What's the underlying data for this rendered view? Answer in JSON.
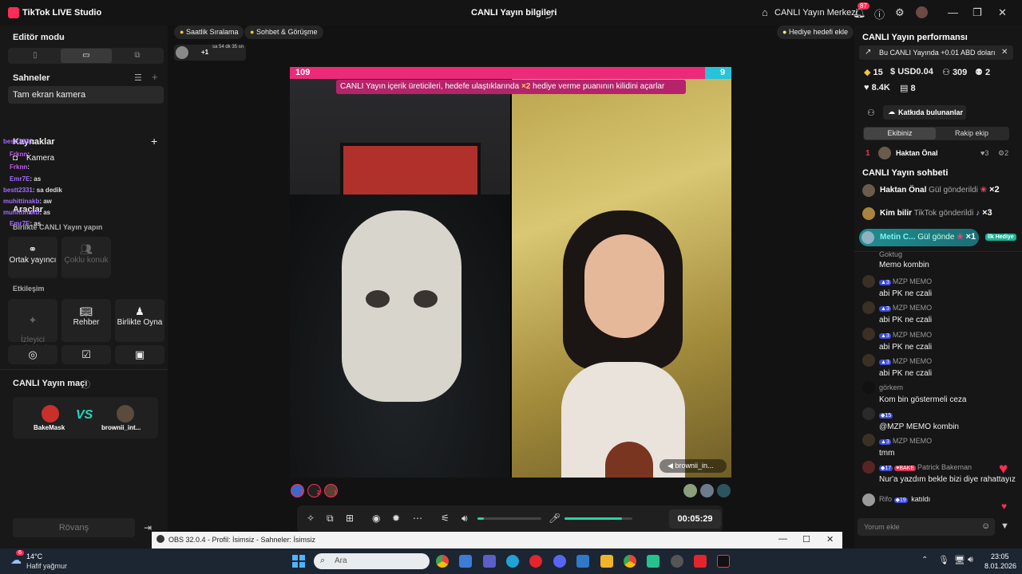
{
  "titlebar": {
    "app_name": "TikTok LIVE Studio",
    "center_title": "CANLI Yayın bilgileri",
    "live_center": "CANLI Yayın Merkezi",
    "notification_count": "87"
  },
  "left": {
    "editor_mode": "Editör modu",
    "scenes_label": "Sahneler",
    "scene_item": "Tam ekran kamera",
    "sources_label": "Kaynaklar",
    "source_camera": "Kamera",
    "tools_label": "Araçlar",
    "collab_label": "Birlikte CANLI Yayın yapın",
    "tiles_collab": [
      {
        "label": "Ortak yayıncı",
        "icon": "link-icon"
      },
      {
        "label": "Çoklu konuk",
        "icon": "people-icon"
      }
    ],
    "interaction_label": "Etkileşim",
    "tiles_interaction": [
      {
        "label": "İzleyici\nDilekleri",
        "icon": "wish-icon"
      },
      {
        "label": "Rehber",
        "icon": "book-icon"
      },
      {
        "label": "Birlikte Oyna",
        "icon": "play-together-icon"
      }
    ],
    "chat_overlay": [
      {
        "user": "bestt2331",
        "msg": ":"
      },
      {
        "user": "Frknn",
        "msg": ":"
      },
      {
        "user": "Frknn",
        "msg": ":"
      },
      {
        "user": "Emr7E",
        "msg": ": as"
      },
      {
        "user": "bestt2331",
        "msg": ": sa dedik"
      },
      {
        "user": "muhittinakb",
        "msg": ": aw"
      },
      {
        "user": "muhittinakb",
        "msg": ": as"
      },
      {
        "user": "Emr7E",
        "msg": ": as"
      }
    ],
    "match_label": "CANLI Yayın maçı",
    "match_players": [
      "BakeMask",
      "brownii_int..."
    ],
    "rematch_button": "Rövanş"
  },
  "center": {
    "pills": [
      "Saatlik Sıralama",
      "Sohbet & Görüşme"
    ],
    "gift_goal": "Hediye hedefi ekle",
    "ranking_small": "sa 54 dk 35 sn",
    "ranking_plus": "+1",
    "score_left": "109",
    "score_right": "9",
    "banner_pre": "CANLI Yayın içerik üreticileri, hedefe ulaştıklarında ",
    "banner_mult": "×2",
    "banner_post": " hediye verme puanının kilidini açarlar",
    "guest_name": "brownii_in...",
    "viewer_counts": [
      "3",
      "2",
      "1"
    ],
    "timer": "00:05:29",
    "volume_level": 0.1,
    "mic_level": 0.85
  },
  "obs": {
    "title": "OBS 32.0.4 - Profil: İsimsiz - Sahneler: İsimsiz"
  },
  "right": {
    "perf_title": "CANLI Yayın performansı",
    "perf_note": "Bu CANLI Yayında +0.01 ABD doları",
    "stats": [
      {
        "icon": "diamond-icon",
        "value": "15"
      },
      {
        "icon": "dollar-icon",
        "value": "USD0.04"
      },
      {
        "icon": "viewers-icon",
        "value": "309"
      },
      {
        "icon": "people-icon",
        "value": "2"
      },
      {
        "icon": "heart-icon",
        "value": "8.4K"
      },
      {
        "icon": "gift-icon",
        "value": "8"
      }
    ],
    "contributors_button": "Katkıda bulunanlar",
    "team_tabs": [
      "Ekibiniz",
      "Rakip ekip"
    ],
    "top_rank": "1",
    "top_name": "Haktan Önal",
    "top_likes": "3",
    "top_gifts": "2",
    "chat_title": "CANLI Yayın sohbeti",
    "gift_feed": [
      {
        "name": "Haktan Önal",
        "msg": "Gül gönderildi",
        "count": "×2"
      },
      {
        "name": "Kim bilir",
        "msg": "TikTok gönderildi",
        "count": "×3"
      },
      {
        "name": "Metin C...",
        "msg": "Gül gönde",
        "count": "×1",
        "tag": "İlk Hediye"
      }
    ],
    "comments": [
      {
        "user": "Goktug",
        "level": "",
        "text": "Memo kombin"
      },
      {
        "user": "MZP MEMO",
        "level": "3",
        "text": "abi PK ne czali"
      },
      {
        "user": "MZP MEMO",
        "level": "3",
        "text": "abi PK ne czali"
      },
      {
        "user": "MZP MEMO",
        "level": "3",
        "text": "abi PK ne czali"
      },
      {
        "user": "MZP MEMO",
        "level": "3",
        "text": "abi PK ne czali"
      },
      {
        "user": "görkem",
        "level": "",
        "text": "Kom bin göstermeli ceza"
      },
      {
        "user": "",
        "level": "15",
        "text": "@MZP MEMO kombin"
      },
      {
        "user": "MZP MEMO",
        "level": "3",
        "text": "tmm"
      },
      {
        "user": "Patrick Bakeman",
        "level": "17",
        "badge": "BAKE",
        "text": "Nur'a yazdım bekle bizi diye rahattayız"
      }
    ],
    "join_user": "Rifo",
    "join_level": "19",
    "join_text": "katıldı",
    "comment_placeholder": "Yorum ekle"
  },
  "taskbar": {
    "weather_temp": "14°C",
    "weather_desc": "Hafif yağmur",
    "search_placeholder": "Ara",
    "time": "23:05",
    "date": "8.01.2026",
    "weather_badge": "6"
  }
}
